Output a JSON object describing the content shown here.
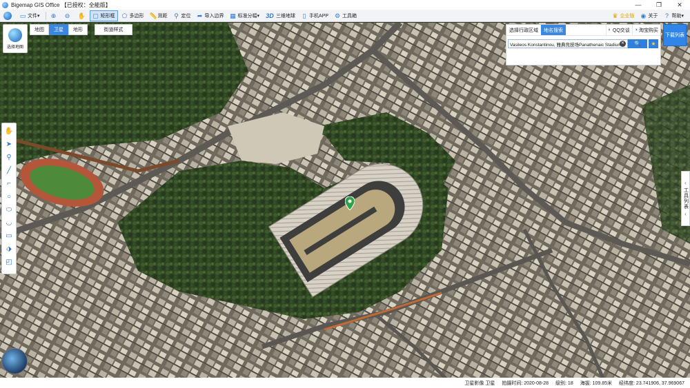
{
  "window": {
    "title": "Bigemap GIS Office 【已授权：全能版】",
    "controls": [
      "—",
      "❐",
      "✕"
    ]
  },
  "toolbar": {
    "items": [
      {
        "label": "文件",
        "icon": "folder-icon",
        "dropdown": "▾"
      },
      {
        "label": "",
        "icon": "zoom-in-icon"
      },
      {
        "label": "",
        "icon": "zoom-out-icon"
      },
      {
        "label": "",
        "icon": "hand-icon"
      },
      {
        "label": "矩形框",
        "icon": "rectangle-select-icon",
        "active": true
      },
      {
        "label": "多边形",
        "icon": "polygon-icon"
      },
      {
        "label": "测距",
        "icon": "ruler-icon"
      },
      {
        "label": "定位",
        "icon": "location-pin-icon"
      },
      {
        "label": "导入边界",
        "icon": "import-icon"
      },
      {
        "label": "标准分幅",
        "icon": "grid-icon",
        "dropdown": "▾"
      },
      {
        "label": "三维地球",
        "icon": "3d-icon",
        "prefix": "3D"
      },
      {
        "label": "手机APP",
        "icon": "phone-icon"
      },
      {
        "label": "工具箱",
        "icon": "toolbox-icon"
      }
    ],
    "right": {
      "enterprise": "企业版",
      "about": "关于",
      "help": "帮助",
      "help_dropdown": "▾"
    }
  },
  "map_switch": {
    "layer_button": "选择地图",
    "types": [
      "地图",
      "卫星",
      "地形"
    ],
    "active_type": "卫星",
    "street_style": "街道样式"
  },
  "region_panel": {
    "tab_admin": "选择行政区域",
    "tab_search": "地名搜索",
    "qq_chat": "QQ交谈",
    "taobao": "淘宝购买",
    "search_value": "Vasileos Konstantinou, 雅典竞技场Panathenaic Stadium",
    "search_icon": "🔍",
    "clear_icon": "✕",
    "star_icon": "★"
  },
  "download_list": "下载列表",
  "tool_list": {
    "label": "工具列表",
    "chevron_top": "‹",
    "chevron_bottom": "‹"
  },
  "left_tools": [
    "hand-icon",
    "arrow-icon",
    "pin-icon",
    "line-icon",
    "polyline-icon",
    "circle-icon",
    "ellipse-icon",
    "curve-icon",
    "rect-icon",
    "tag-icon",
    "shape-icon"
  ],
  "status": {
    "source": "卫星影像 卫星",
    "shot_time": "拍摄时间: 2020-08-28",
    "level": "级别: 18",
    "altitude": "海拔: 109.85米",
    "coords": "经纬度: 23.741906, 37.969067"
  },
  "colors": {
    "accent": "#3a86e0",
    "toolbar_bg": "#f1f3f6",
    "marker": "#2fa24a"
  }
}
